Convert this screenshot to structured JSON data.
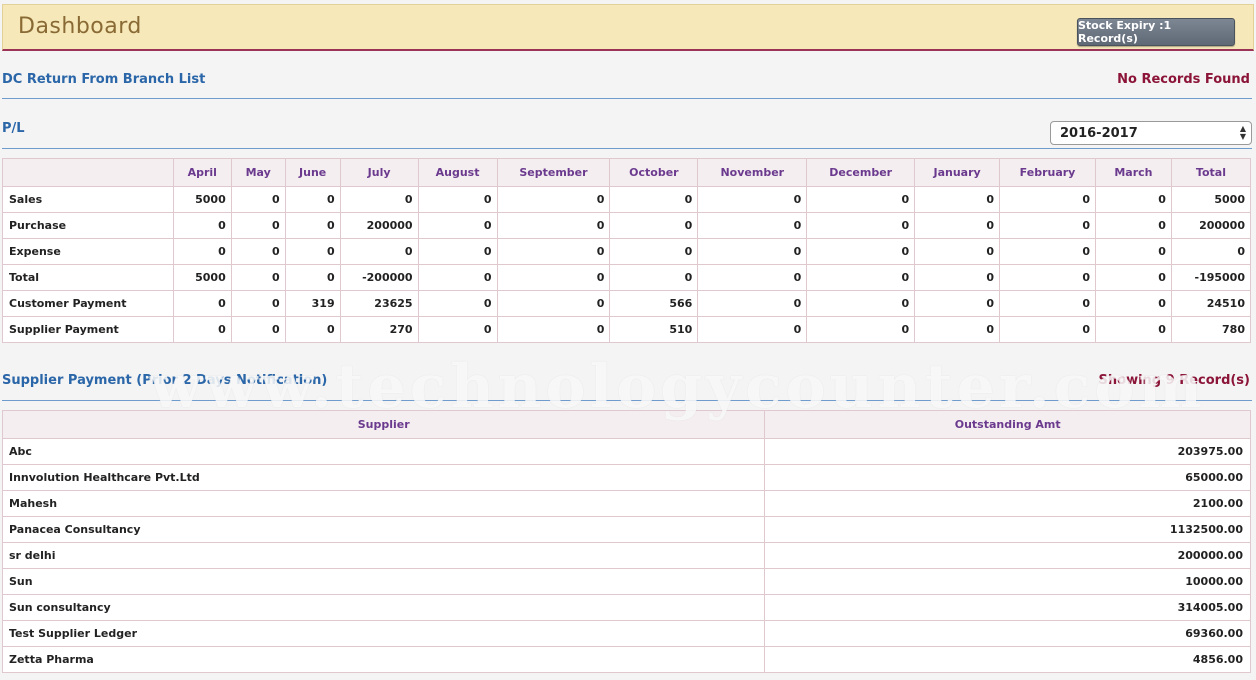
{
  "header": {
    "title": "Dashboard",
    "stock_expiry_label": "Stock Expiry :1 Record(s)"
  },
  "dc_return": {
    "title": "DC Return From Branch List",
    "status": "No Records Found"
  },
  "pl": {
    "title": "P/L",
    "year_selected": "2016-2017",
    "columns": [
      "",
      "April",
      "May",
      "June",
      "July",
      "August",
      "September",
      "October",
      "November",
      "December",
      "January",
      "February",
      "March",
      "Total"
    ],
    "rows": [
      {
        "label": "Sales",
        "values": [
          "5000",
          "0",
          "0",
          "0",
          "0",
          "0",
          "0",
          "0",
          "0",
          "0",
          "0",
          "0",
          "5000"
        ]
      },
      {
        "label": "Purchase",
        "values": [
          "0",
          "0",
          "0",
          "200000",
          "0",
          "0",
          "0",
          "0",
          "0",
          "0",
          "0",
          "0",
          "200000"
        ]
      },
      {
        "label": "Expense",
        "values": [
          "0",
          "0",
          "0",
          "0",
          "0",
          "0",
          "0",
          "0",
          "0",
          "0",
          "0",
          "0",
          "0"
        ]
      },
      {
        "label": "Total",
        "values": [
          "5000",
          "0",
          "0",
          "-200000",
          "0",
          "0",
          "0",
          "0",
          "0",
          "0",
          "0",
          "0",
          "-195000"
        ]
      },
      {
        "label": "Customer Payment",
        "values": [
          "0",
          "0",
          "319",
          "23625",
          "0",
          "0",
          "566",
          "0",
          "0",
          "0",
          "0",
          "0",
          "24510"
        ]
      },
      {
        "label": "Supplier Payment",
        "values": [
          "0",
          "0",
          "0",
          "270",
          "0",
          "0",
          "510",
          "0",
          "0",
          "0",
          "0",
          "0",
          "780"
        ]
      }
    ]
  },
  "supplier_payment": {
    "title": "Supplier Payment (Prior 2 Days Notification)",
    "count": "Showing 9 Record(s)",
    "columns": [
      "Supplier",
      "Outstanding Amt"
    ],
    "rows": [
      {
        "supplier": "Abc",
        "amount": "203975.00"
      },
      {
        "supplier": "Innvolution Healthcare Pvt.Ltd",
        "amount": "65000.00"
      },
      {
        "supplier": "Mahesh",
        "amount": "2100.00"
      },
      {
        "supplier": "Panacea Consultancy",
        "amount": "1132500.00"
      },
      {
        "supplier": "sr delhi",
        "amount": "200000.00"
      },
      {
        "supplier": "Sun",
        "amount": "10000.00"
      },
      {
        "supplier": "Sun consultancy",
        "amount": "314005.00"
      },
      {
        "supplier": "Test Supplier Ledger",
        "amount": "69360.00"
      },
      {
        "supplier": "Zetta Pharma",
        "amount": "4856.00"
      }
    ]
  },
  "watermark": "www.technologycounter.com"
}
